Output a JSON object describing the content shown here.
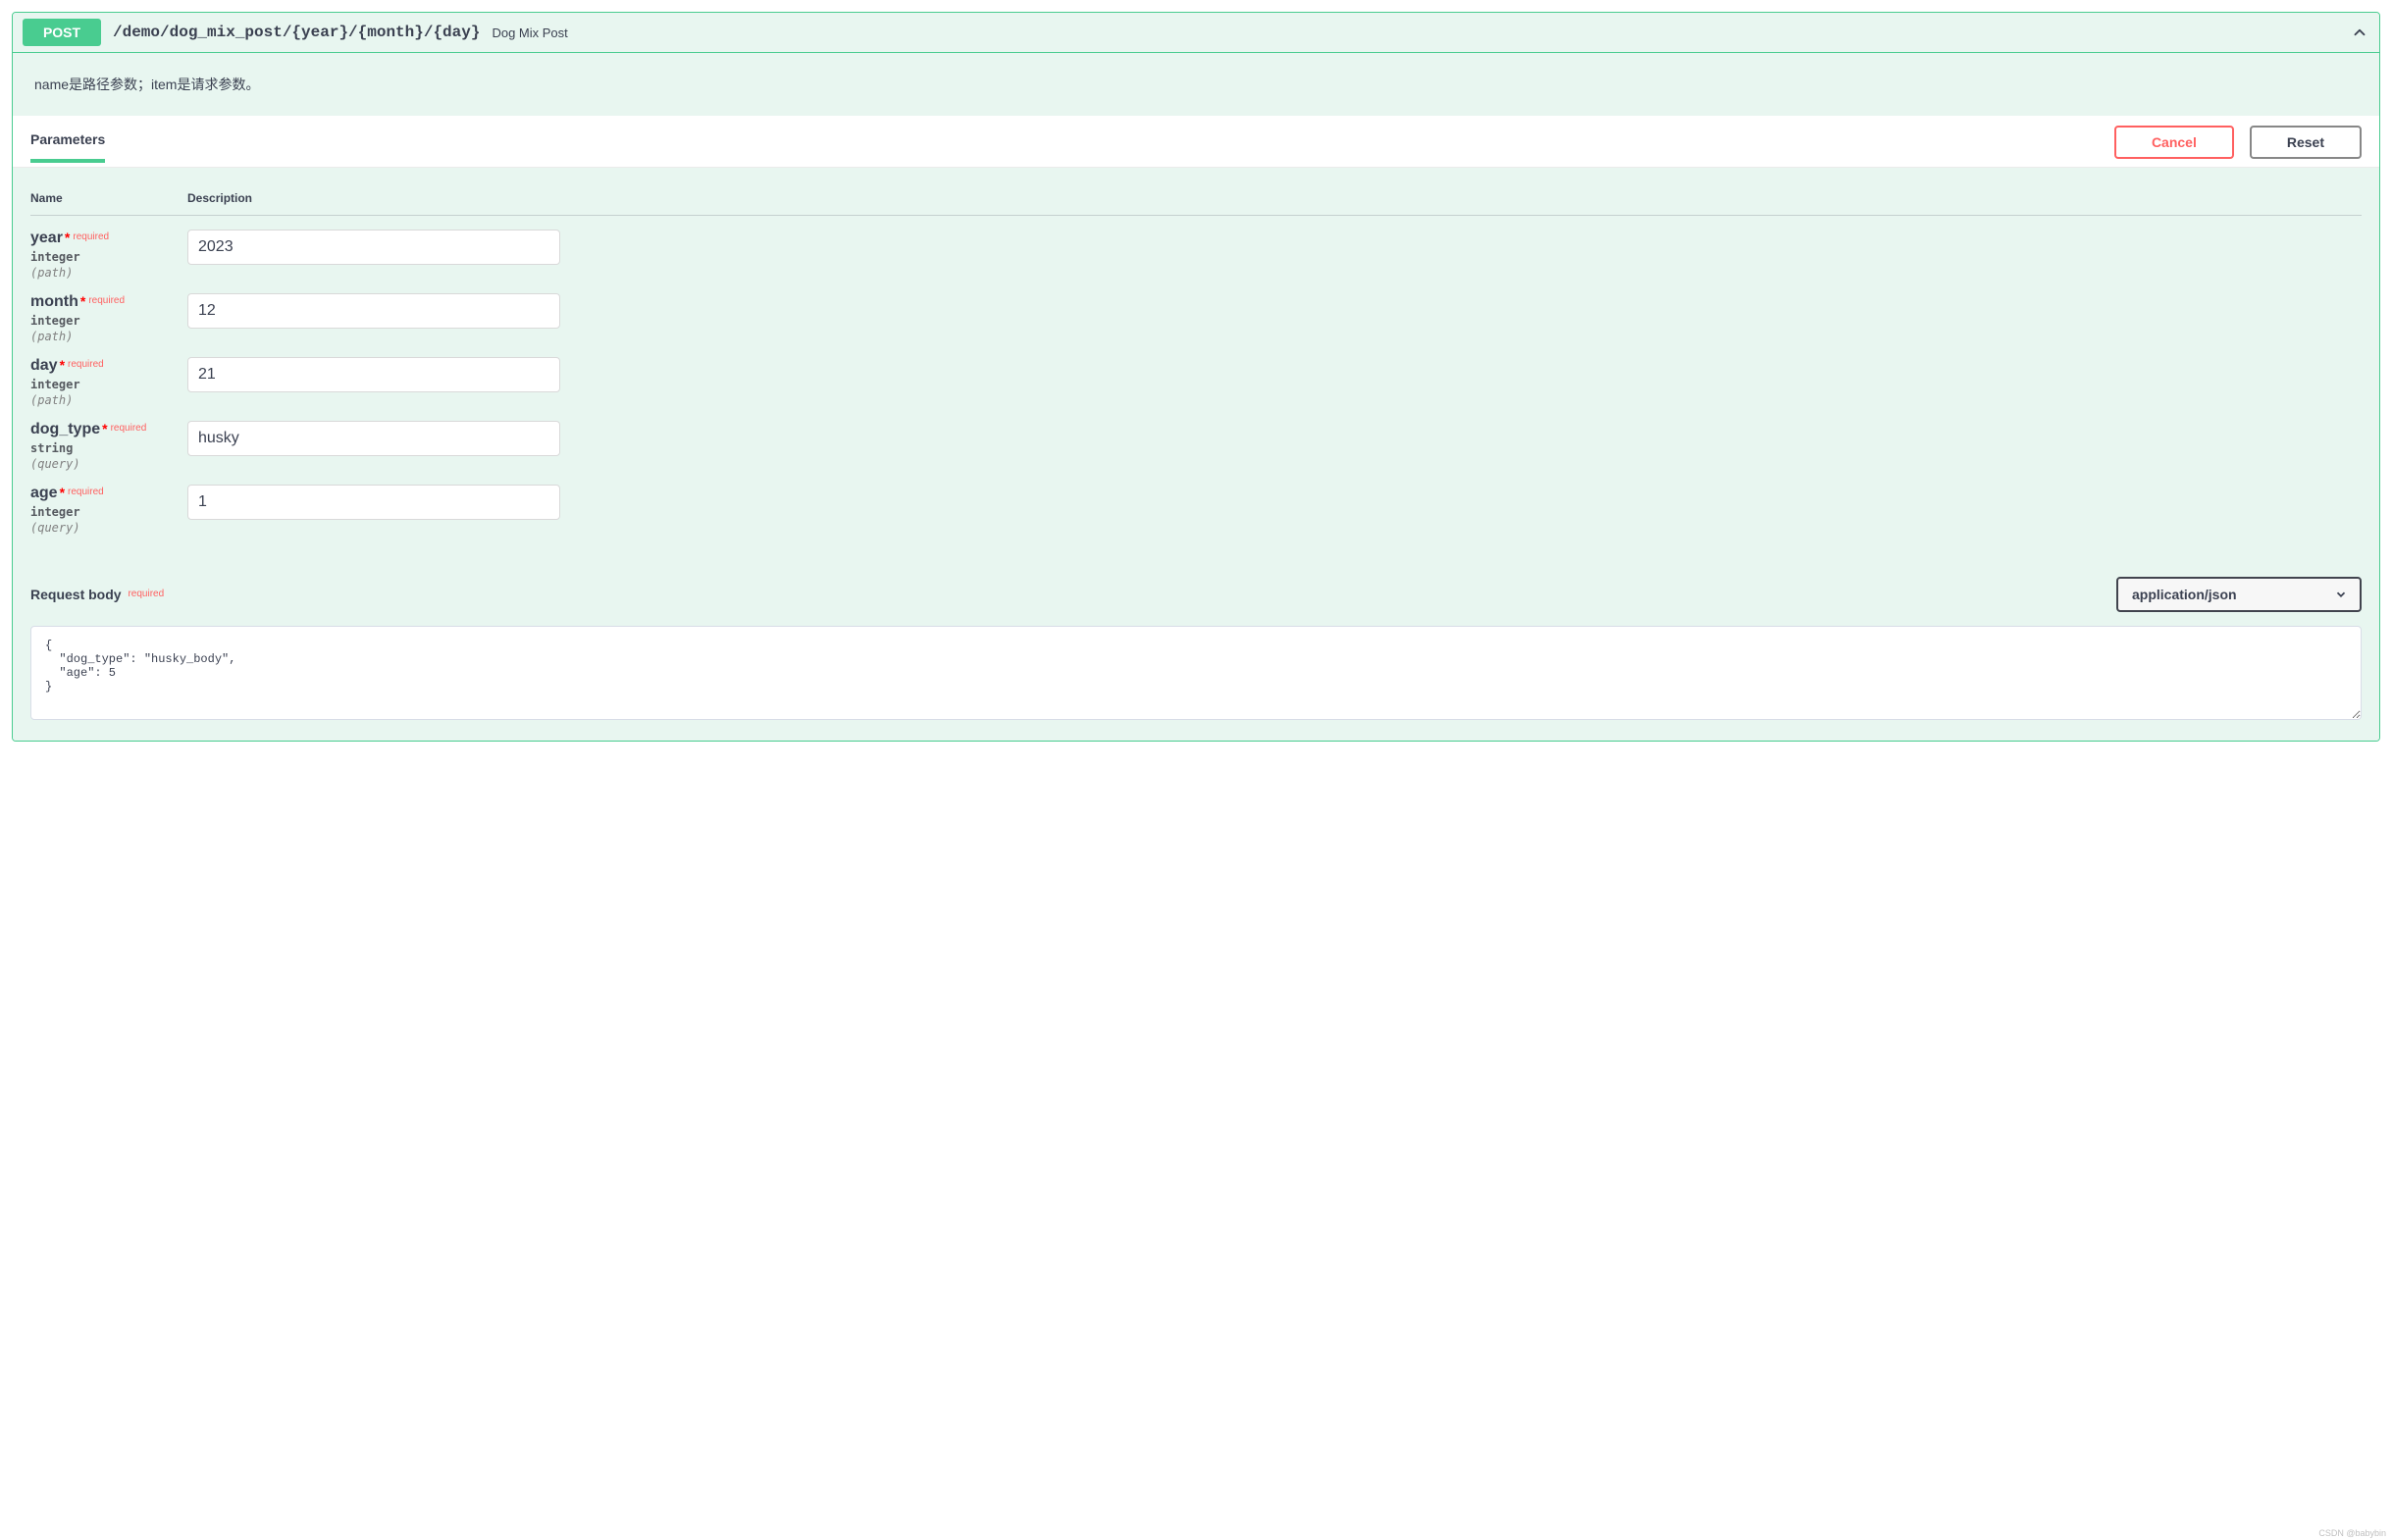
{
  "summary": {
    "method": "POST",
    "path": "/demo/dog_mix_post/{year}/{month}/{day}",
    "title": "Dog Mix Post"
  },
  "description": "name是路径参数；item是请求参数。",
  "section": {
    "parameters_tab": "Parameters",
    "cancel": "Cancel",
    "reset": "Reset"
  },
  "columns": {
    "name": "Name",
    "description": "Description"
  },
  "required_label": "required",
  "params": [
    {
      "name": "year",
      "type": "integer",
      "in": "(path)",
      "value": "2023"
    },
    {
      "name": "month",
      "type": "integer",
      "in": "(path)",
      "value": "12"
    },
    {
      "name": "day",
      "type": "integer",
      "in": "(path)",
      "value": "21"
    },
    {
      "name": "dog_type",
      "type": "string",
      "in": "(query)",
      "value": "husky"
    },
    {
      "name": "age",
      "type": "integer",
      "in": "(query)",
      "value": "1"
    }
  ],
  "request_body": {
    "label": "Request body",
    "content_type": "application/json",
    "body": "{\n  \"dog_type\": \"husky_body\",\n  \"age\": 5\n}"
  },
  "watermark": "CSDN @babybin"
}
